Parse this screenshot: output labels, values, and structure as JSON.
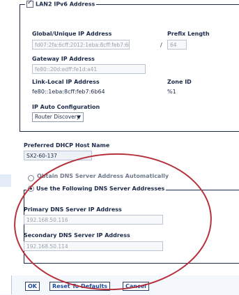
{
  "lan2": {
    "legend": "LAN2 IPv6 Address",
    "global_label": "Global/Unique IP Address",
    "prefix_label": "Prefix Length",
    "global_value": "fd07:2fa:6cff:2012:1eba:8cff:feb7:6b66",
    "slash": "/",
    "prefix_value": "64",
    "gateway_label": "Gateway IP Address",
    "gateway_value": "fe80::20d:edff:fe1d:a41",
    "link_local_label": "Link-Local IP Address",
    "zone_label": "Zone ID",
    "link_local_value": "fe80::1eba:8cff:feb7:6b64",
    "zone_value": "%1",
    "auto_config_label": "IP Auto Configuration",
    "auto_config_value": "Router Discovery",
    "caret": "▼",
    "checkbox_tick": "✓"
  },
  "dhcp": {
    "hostname_label": "Preferred DHCP Host Name",
    "hostname_value": "SX2-60-137"
  },
  "dns": {
    "auto_option": "Obtain DNS Server Address Automatically",
    "manual_option": "Use the Following DNS Server Addresses",
    "primary_label": "Primary DNS Server IP Address",
    "primary_value": "192.168.50.116",
    "secondary_label": "Secondary DNS Server IP Address",
    "secondary_value": "192.168.50.114"
  },
  "buttons": {
    "ok": "OK",
    "reset": "Reset To Defaults",
    "cancel": "Cancel"
  },
  "colors": {
    "annotation_ellipse": "#b5313b",
    "text": "#1b2a48",
    "button_text": "#1b4b9a"
  }
}
